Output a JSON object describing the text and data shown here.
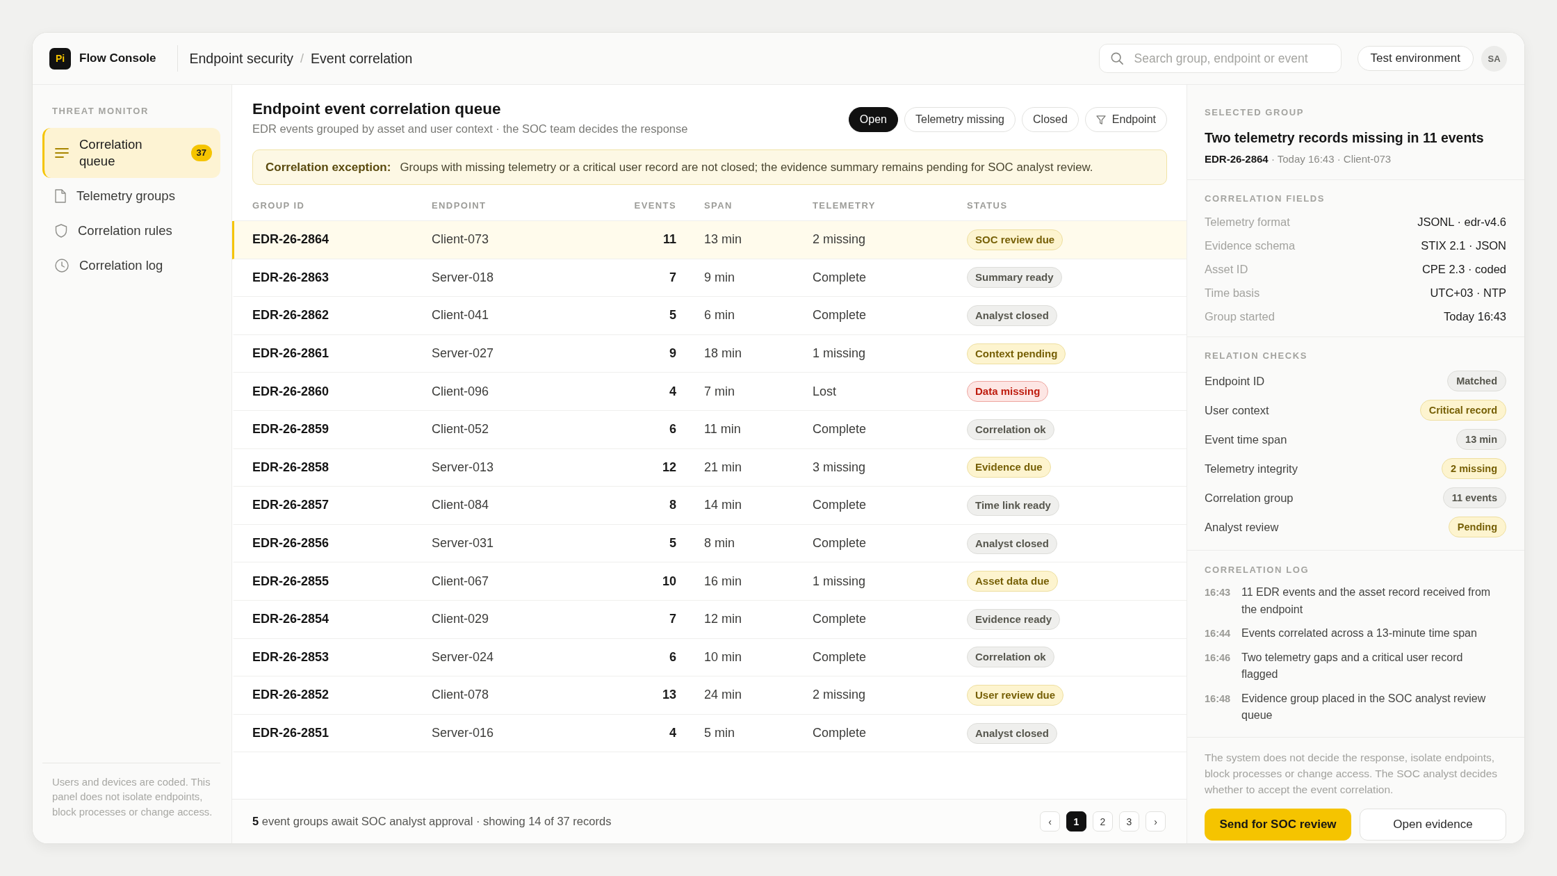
{
  "app": {
    "logo": "Pi",
    "name": "Flow Console"
  },
  "breadcrumb": {
    "items": [
      "Endpoint security",
      "Event correlation"
    ],
    "separator": "/"
  },
  "search": {
    "placeholder": "Search group, endpoint or event"
  },
  "environment": "Test environment",
  "user": {
    "initials": "SA"
  },
  "sidebar": {
    "heading": "THREAT MONITOR",
    "items": [
      {
        "label": "Correlation queue",
        "selected": true,
        "count": "37"
      },
      {
        "label": "Telemetry groups",
        "selected": false
      },
      {
        "label": "Correlation rules",
        "selected": false
      },
      {
        "label": "Correlation log",
        "selected": false
      }
    ],
    "note": "Users and devices are coded. This panel does not isolate endpoints, block processes or change access."
  },
  "main": {
    "title": "Endpoint event correlation queue",
    "subtitle": "EDR events grouped by asset and user context · the SOC team decides the response",
    "filters": [
      {
        "label": "Open",
        "selected": true
      },
      {
        "label": "Telemetry missing",
        "selected": false
      },
      {
        "label": "Closed",
        "selected": false
      }
    ],
    "endpoint_filter": {
      "label": "Endpoint"
    },
    "exception": {
      "label": "Correlation exception:",
      "text": "Groups with missing telemetry or a critical user record are not closed; the evidence summary remains pending for SOC analyst review."
    }
  },
  "table": {
    "columns": [
      "GROUP ID",
      "ENDPOINT",
      "EVENTS",
      "SPAN",
      "TELEMETRY",
      "STATUS"
    ],
    "rows": [
      {
        "group_id": "EDR-26-2864",
        "endpoint": "Client-073",
        "events": "11",
        "span": "13 min",
        "telemetry": "2 missing",
        "status": {
          "label": "SOC review due",
          "color": "#fdf4cf"
        },
        "selected": true
      },
      {
        "group_id": "EDR-26-2863",
        "endpoint": "Server-018",
        "events": "7",
        "span": "9 min",
        "telemetry": "Complete",
        "status": {
          "label": "Summary ready",
          "color": "#efefed"
        },
        "selected": false
      },
      {
        "group_id": "EDR-26-2862",
        "endpoint": "Client-041",
        "events": "5",
        "span": "6 min",
        "telemetry": "Complete",
        "status": {
          "label": "Analyst closed",
          "color": "#efefed"
        },
        "selected": false
      },
      {
        "group_id": "EDR-26-2861",
        "endpoint": "Server-027",
        "events": "9",
        "span": "18 min",
        "telemetry": "1 missing",
        "status": {
          "label": "Context pending",
          "color": "#fdf4cf"
        },
        "selected": false
      },
      {
        "group_id": "EDR-26-2860",
        "endpoint": "Client-096",
        "events": "4",
        "span": "7 min",
        "telemetry": "Lost",
        "status": {
          "label": "Data missing",
          "color": "#fde6e4"
        },
        "selected": false
      },
      {
        "group_id": "EDR-26-2859",
        "endpoint": "Client-052",
        "events": "6",
        "span": "11 min",
        "telemetry": "Complete",
        "status": {
          "label": "Correlation ok",
          "color": "#efefed"
        },
        "selected": false
      },
      {
        "group_id": "EDR-26-2858",
        "endpoint": "Server-013",
        "events": "12",
        "span": "21 min",
        "telemetry": "3 missing",
        "status": {
          "label": "Evidence due",
          "color": "#fdf4cf"
        },
        "selected": false
      },
      {
        "group_id": "EDR-26-2857",
        "endpoint": "Client-084",
        "events": "8",
        "span": "14 min",
        "telemetry": "Complete",
        "status": {
          "label": "Time link ready",
          "color": "#efefed"
        },
        "selected": false
      },
      {
        "group_id": "EDR-26-2856",
        "endpoint": "Server-031",
        "events": "5",
        "span": "8 min",
        "telemetry": "Complete",
        "status": {
          "label": "Analyst closed",
          "color": "#efefed"
        },
        "selected": false
      },
      {
        "group_id": "EDR-26-2855",
        "endpoint": "Client-067",
        "events": "10",
        "span": "16 min",
        "telemetry": "1 missing",
        "status": {
          "label": "Asset data due",
          "color": "#fdf4cf"
        },
        "selected": false
      },
      {
        "group_id": "EDR-26-2854",
        "endpoint": "Client-029",
        "events": "7",
        "span": "12 min",
        "telemetry": "Complete",
        "status": {
          "label": "Evidence ready",
          "color": "#efefed"
        },
        "selected": false
      },
      {
        "group_id": "EDR-26-2853",
        "endpoint": "Server-024",
        "events": "6",
        "span": "10 min",
        "telemetry": "Complete",
        "status": {
          "label": "Correlation ok",
          "color": "#efefed"
        },
        "selected": false
      },
      {
        "group_id": "EDR-26-2852",
        "endpoint": "Client-078",
        "events": "13",
        "span": "24 min",
        "telemetry": "2 missing",
        "status": {
          "label": "User review due",
          "color": "#fdf4cf"
        },
        "selected": false
      },
      {
        "group_id": "EDR-26-2851",
        "endpoint": "Server-016",
        "events": "4",
        "span": "5 min",
        "telemetry": "Complete",
        "status": {
          "label": "Analyst closed",
          "color": "#efefed"
        },
        "selected": false
      }
    ]
  },
  "footer": {
    "summary": "**5** event groups await SOC analyst approval · showing 14 of 37 records",
    "pagination": {
      "previous": "‹",
      "pages": [
        {
          "label": "1",
          "selected": true
        },
        {
          "label": "2",
          "selected": false
        },
        {
          "label": "3",
          "selected": false
        }
      ],
      "next": "›"
    }
  },
  "detail": {
    "heading": "SELECTED GROUP",
    "title": "Two telemetry records missing in 11 events",
    "meta": "**EDR-26-2864** · Today 16:43 · Client-073",
    "fields": {
      "heading": "CORRELATION FIELDS",
      "rows": [
        {
          "label": "Telemetry format",
          "value": "JSONL · edr-v4.6"
        },
        {
          "label": "Evidence schema",
          "value": "STIX 2.1 · JSON"
        },
        {
          "label": "Asset ID",
          "value": "CPE 2.3 · coded"
        },
        {
          "label": "Time basis",
          "value": "UTC+03 · NTP"
        },
        {
          "label": "Group started",
          "value": "Today 16:43"
        }
      ]
    },
    "checks": {
      "heading": "RELATION CHECKS",
      "rows": [
        {
          "label": "Endpoint ID",
          "value": "Matched",
          "color": "#efefed"
        },
        {
          "label": "User context",
          "value": "Critical record",
          "color": "#fdf4cf"
        },
        {
          "label": "Event time span",
          "value": "13 min",
          "color": "#efefed"
        },
        {
          "label": "Telemetry integrity",
          "value": "2 missing",
          "color": "#fdf4cf"
        },
        {
          "label": "Correlation group",
          "value": "11 events",
          "color": "#efefed"
        },
        {
          "label": "Analyst review",
          "value": "Pending",
          "color": "#fdf4cf"
        }
      ]
    },
    "log": {
      "heading": "CORRELATION LOG",
      "entries": [
        {
          "time": "16:43",
          "text": "11 EDR events and the asset record received from the endpoint"
        },
        {
          "time": "16:44",
          "text": "Events correlated across a 13-minute time span"
        },
        {
          "time": "16:46",
          "text": "Two telemetry gaps and a critical user record flagged"
        },
        {
          "time": "16:48",
          "text": "Evidence group placed in the SOC analyst review queue"
        }
      ]
    },
    "disclaimer": "The system does not decide the response, isolate endpoints, block processes or change access. The SOC analyst decides whether to accept the event correlation.",
    "actions": [
      {
        "label": "Send for SOC review",
        "kind": "primary"
      },
      {
        "label": "Open evidence",
        "kind": "secondary"
      }
    ]
  }
}
